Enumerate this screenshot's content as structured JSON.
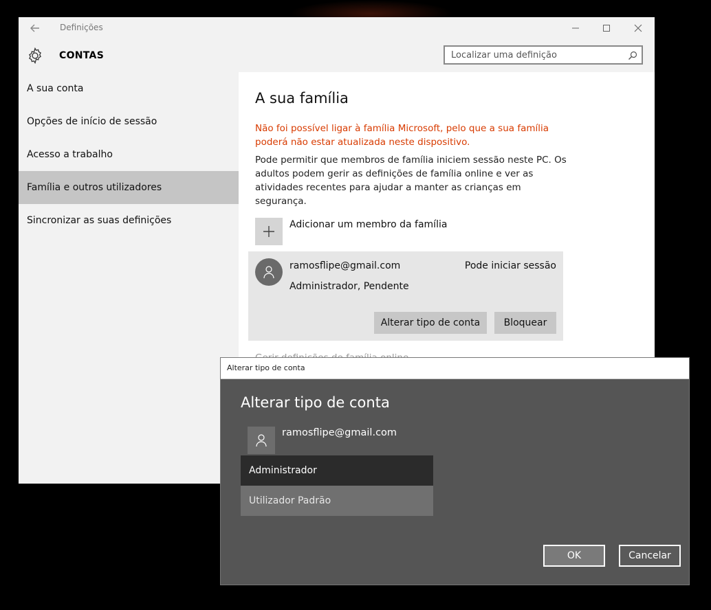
{
  "window": {
    "title": "Definições",
    "section_title": "CONTAS"
  },
  "search": {
    "placeholder": "Localizar uma definição"
  },
  "sidebar": {
    "items": [
      {
        "label": "A sua conta"
      },
      {
        "label": "Opções de início de sessão"
      },
      {
        "label": "Acesso a trabalho"
      },
      {
        "label": "Família e outros utilizadores"
      },
      {
        "label": "Sincronizar as suas definições"
      }
    ],
    "selected_index": 3
  },
  "main": {
    "heading": "A sua família",
    "error": "Não foi possível ligar à família Microsoft, pelo que a sua família poderá não estar atualizada neste dispositivo.",
    "description": "Pode permitir que membros de família iniciem sessão neste PC. Os adultos podem gerir as definições de família online e ver as atividades recentes para ajudar a manter as crianças em segurança.",
    "add_member_label": "Adicionar um membro da família",
    "member": {
      "email": "ramosflipe@gmail.com",
      "status": "Pode iniciar sessão",
      "role": "Administrador, Pendente",
      "change_type_label": "Alterar tipo de conta",
      "block_label": "Bloquear"
    },
    "manage_link": "Gerir definições de família online"
  },
  "dialog": {
    "window_title": "Alterar tipo de conta",
    "heading": "Alterar tipo de conta",
    "email": "ramosflipe@gmail.com",
    "options": [
      {
        "label": "Administrador"
      },
      {
        "label": "Utilizador Padrão"
      }
    ],
    "selected_option": "Administrador",
    "ok_label": "OK",
    "cancel_label": "Cancelar"
  },
  "colors": {
    "error_text": "#d83b01",
    "sidebar_selected": "#c5c5c5",
    "dialog_bg": "#555555",
    "option_selected": "#2b2b2b"
  }
}
